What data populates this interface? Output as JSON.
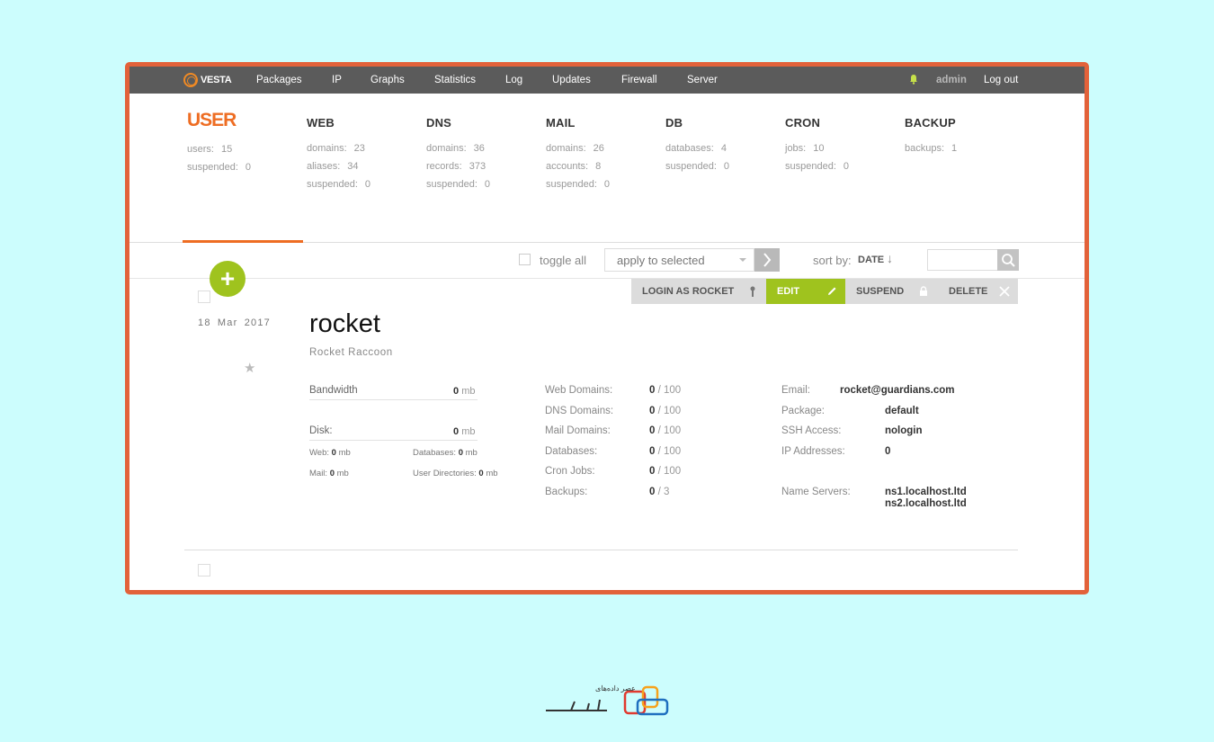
{
  "nav": {
    "logo": "VESTA",
    "items": [
      "Packages",
      "IP",
      "Graphs",
      "Statistics",
      "Log",
      "Updates",
      "Firewall",
      "Server"
    ],
    "user": "admin",
    "logout": "Log out"
  },
  "stats": [
    {
      "title": "USER",
      "rows": [
        [
          "users:",
          "15"
        ],
        [
          "suspended:",
          "0"
        ]
      ]
    },
    {
      "title": "WEB",
      "rows": [
        [
          "domains:",
          "23"
        ],
        [
          "aliases:",
          "34"
        ],
        [
          "suspended:",
          "0"
        ]
      ]
    },
    {
      "title": "DNS",
      "rows": [
        [
          "domains:",
          "36"
        ],
        [
          "records:",
          "373"
        ],
        [
          "suspended:",
          "0"
        ]
      ]
    },
    {
      "title": "MAIL",
      "rows": [
        [
          "domains:",
          "26"
        ],
        [
          "accounts:",
          "8"
        ],
        [
          "suspended:",
          "0"
        ]
      ]
    },
    {
      "title": "DB",
      "rows": [
        [
          "databases:",
          "4"
        ],
        [
          "suspended:",
          "0"
        ]
      ]
    },
    {
      "title": "CRON",
      "rows": [
        [
          "jobs:",
          "10"
        ],
        [
          "suspended:",
          "0"
        ]
      ]
    },
    {
      "title": "BACKUP",
      "rows": [
        [
          "backups:",
          "1"
        ]
      ]
    }
  ],
  "toolbar": {
    "toggle_all": "toggle all",
    "apply_placeholder": "apply to selected",
    "sort_label": "sort by:",
    "sort_value": "DATE",
    "sort_arrow": "↓"
  },
  "add_button": "+",
  "row": {
    "date": "18 Mar 2017",
    "star": "★",
    "username": "rocket",
    "fullname": "Rocket Raccoon",
    "actions": {
      "login": "LOGIN AS ROCKET",
      "edit": "EDIT",
      "suspend": "SUSPEND",
      "delete": "DELETE"
    },
    "usage": {
      "bandwidth_label": "Bandwidth",
      "bandwidth_value": "0",
      "disk_label": "Disk:",
      "disk_value": "0",
      "unit": "mb",
      "web_label": "Web:",
      "web_value": "0",
      "databases_label": "Databases:",
      "databases_value": "0",
      "mail_label": "Mail:",
      "mail_value": "0",
      "userdirs_label": "User Directories:",
      "userdirs_value": "0"
    },
    "limits": [
      {
        "label": "Web Domains:",
        "used": "0",
        "max": "100"
      },
      {
        "label": "DNS Domains:",
        "used": "0",
        "max": "100"
      },
      {
        "label": "Mail Domains:",
        "used": "0",
        "max": "100"
      },
      {
        "label": "Databases:",
        "used": "0",
        "max": "100"
      },
      {
        "label": "Cron Jobs:",
        "used": "0",
        "max": "100"
      },
      {
        "label": "Backups:",
        "used": "0",
        "max": "3"
      }
    ],
    "info": {
      "email_label": "Email:",
      "email_value": "rocket@guardians.com",
      "package_label": "Package:",
      "package_value": "default",
      "ssh_label": "SSH Access:",
      "ssh_value": "nologin",
      "ip_label": "IP Addresses:",
      "ip_value": "0",
      "ns_label": "Name Servers:",
      "ns1": "ns1.localhost.ltd",
      "ns2": "ns2.localhost.ltd"
    }
  },
  "watermark": {
    "text": "عصر داده‌های"
  },
  "colors": {
    "frame": "#e2623a",
    "accent": "#ee6d23",
    "green": "#9fc31e",
    "nav_bg": "#5b5b5b",
    "page_bg": "#ccfdfd"
  }
}
